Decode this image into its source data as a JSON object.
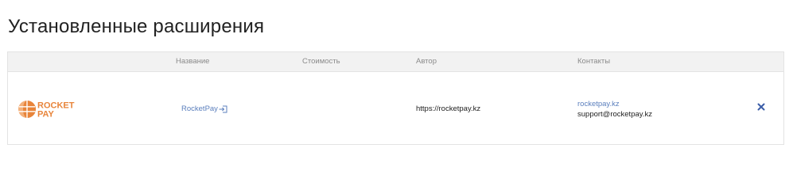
{
  "page": {
    "title": "Установленные расширения"
  },
  "table": {
    "columns": [
      "Название",
      "Стоимость",
      "Автор",
      "Контакты"
    ],
    "rows": [
      {
        "logo": {
          "line1": "ROCKET",
          "line2": "PAY",
          "icon": "globe-logo-icon"
        },
        "name": "RocketPay",
        "name_icon": "external-login-icon",
        "cost": "",
        "author": "https://rocketpay.kz",
        "contacts": {
          "link": "rocketpay.kz",
          "email": "support@rocketpay.kz"
        },
        "remove_icon": "close-icon"
      }
    ]
  },
  "colors": {
    "link": "#5b7fbd",
    "brand": "#e8843a",
    "remove": "#3b5da8",
    "header_bg": "#f2f2f2"
  }
}
